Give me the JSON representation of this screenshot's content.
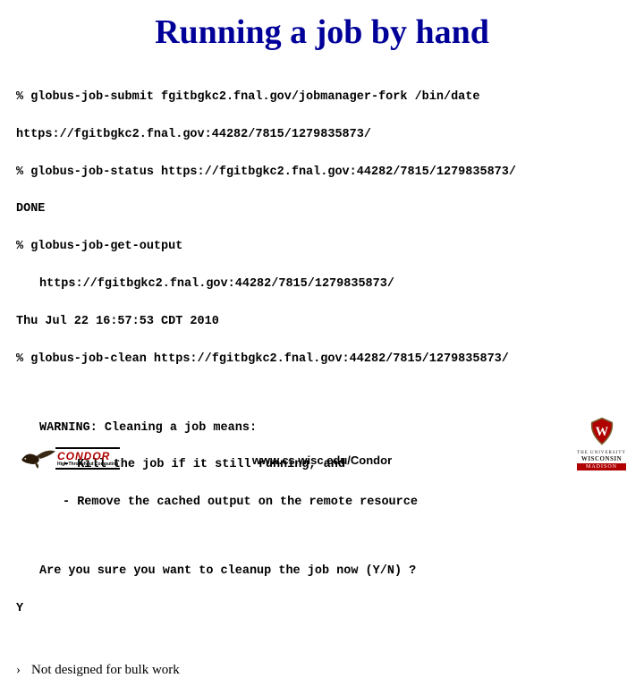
{
  "title": "Running a job by hand",
  "lines": {
    "l1": "% globus-job-submit fgitbgkc2.fnal.gov/jobmanager-fork /bin/date",
    "l2": "https://fgitbgkc2.fnal.gov:44282/7815/1279835873/",
    "l3": "% globus-job-status https://fgitbgkc2.fnal.gov:44282/7815/1279835873/",
    "l4": "DONE",
    "l5": "% globus-job-get-output",
    "l6": "https://fgitbgkc2.fnal.gov:44282/7815/1279835873/",
    "l7": "Thu Jul 22 16:57:53 CDT 2010",
    "l8": "% globus-job-clean https://fgitbgkc2.fnal.gov:44282/7815/1279835873/",
    "w1": "WARNING: Cleaning a job means:",
    "w2": "- Kill the job if it still running, and",
    "w3": "- Remove the cached output on the remote resource",
    "q1": "Are you sure you want to cleanup the job now (Y/N) ?",
    "y": "Y"
  },
  "bullet_marker": "›",
  "bullet_text": "Not designed for bulk work",
  "footer_url": "www.cs.wisc.edu/Condor",
  "logos": {
    "condor_text": "CONDOR",
    "condor_sub": "High Throughput Computing",
    "uw_line1": "THE UNIVERSITY",
    "uw_line2": "WISCONSIN",
    "uw_line3": "MADISON"
  }
}
